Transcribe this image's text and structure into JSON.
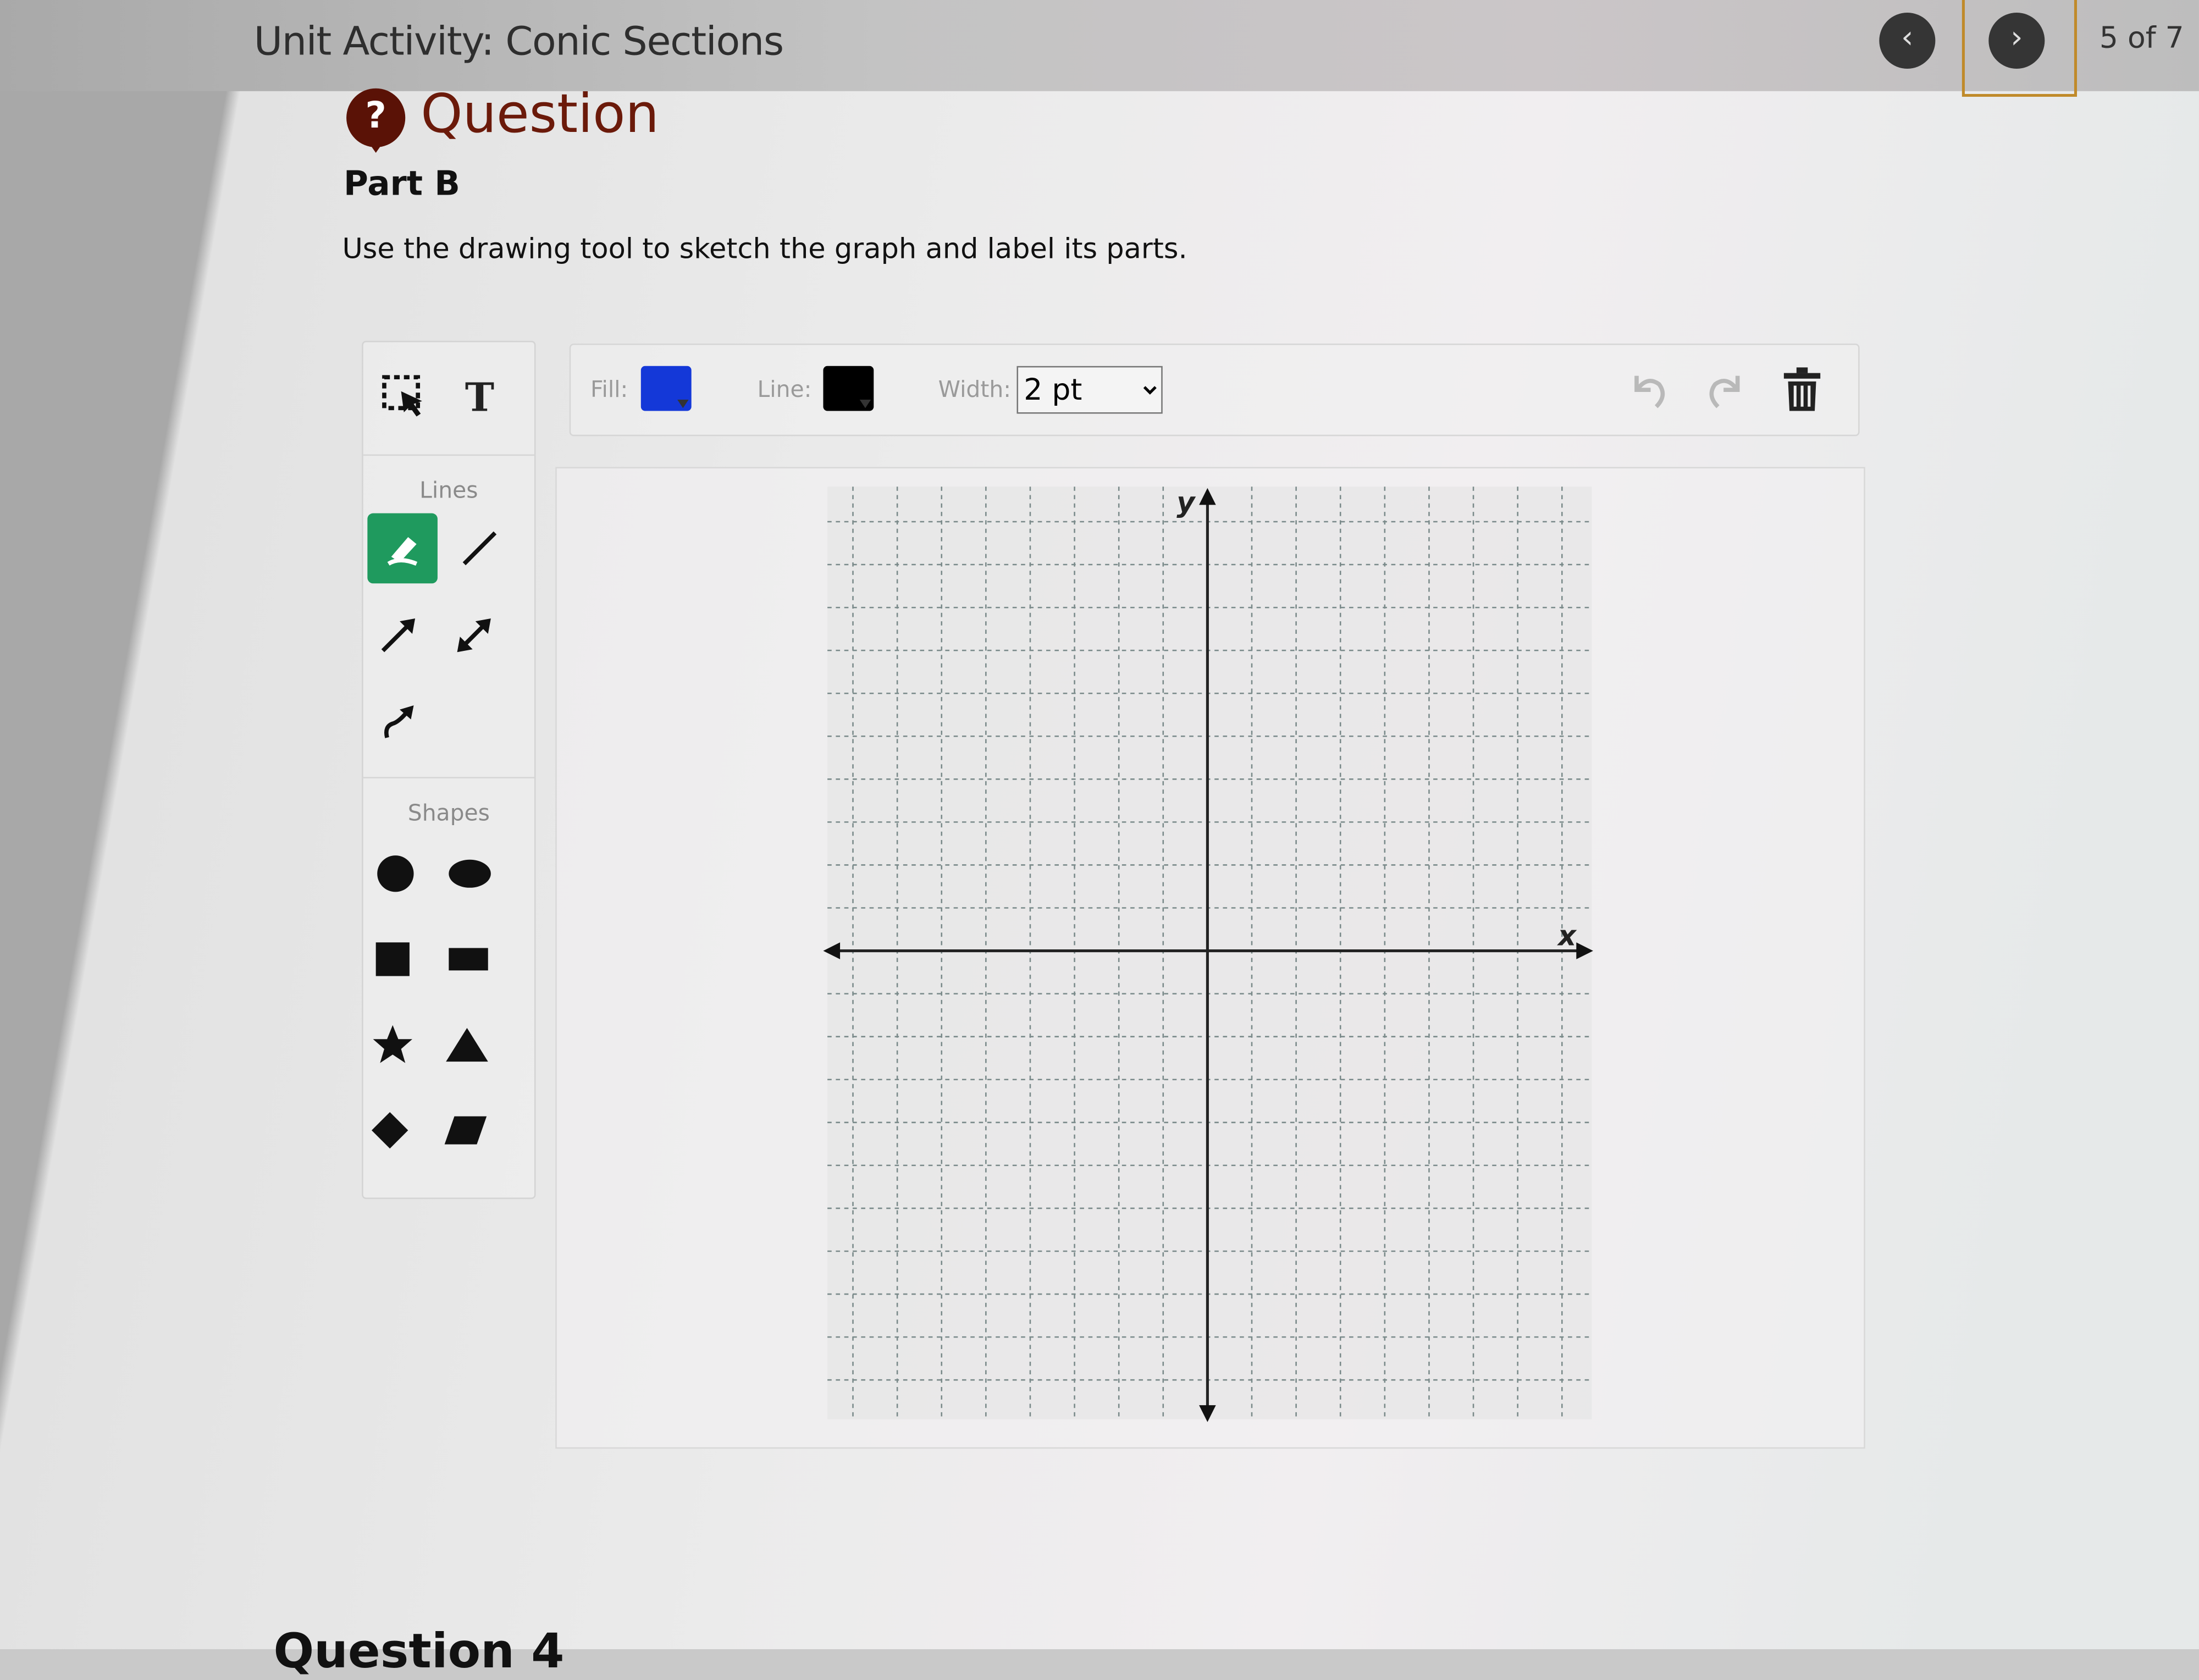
{
  "header": {
    "title": "Unit Activity: Conic Sections",
    "pager": "5 of 7",
    "prev_icon": "chevron-left-icon",
    "next_icon": "chevron-right-icon"
  },
  "question": {
    "icon": "question-bubble-icon",
    "icon_glyph": "?",
    "heading": "Question",
    "part": "Part B",
    "instruction": "Use the drawing tool to sketch the graph and label its parts."
  },
  "palette": {
    "lines_label": "Lines",
    "shapes_label": "Shapes",
    "text_tool_glyph": "T",
    "active_tool": "freehand-pencil",
    "accent": "#1f9a5e"
  },
  "toolbar": {
    "fill_label": "Fill:",
    "fill_color": "#1438d8",
    "line_label": "Line:",
    "line_color": "#000000",
    "width_label": "Width:",
    "width_value": "2 pt"
  },
  "graph": {
    "x_label": "x",
    "y_label": "y"
  },
  "next_section": "Question 4"
}
